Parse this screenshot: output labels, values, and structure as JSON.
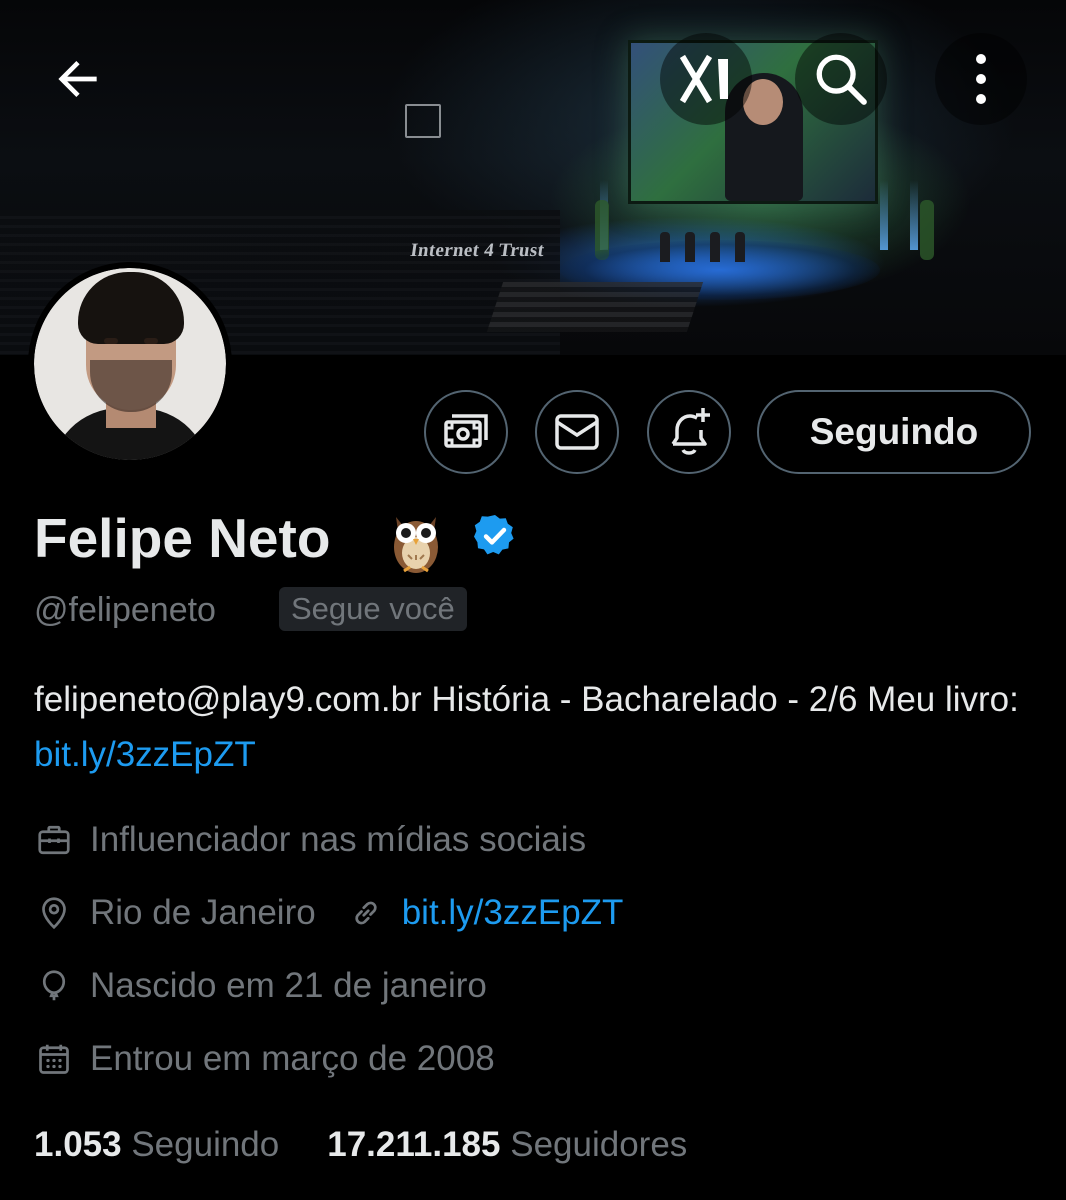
{
  "banner": {
    "sign_text": "Internet 4 Trust"
  },
  "profile": {
    "name": "Felipe Neto",
    "name_emoji": "owl",
    "verified": true,
    "handle": "@felipeneto",
    "follows_you_label": "Segue você",
    "bio": {
      "text": "felipeneto@play9.com.br História - Bacharelado - 2/6  Meu livro: ",
      "link": "bit.ly/3zzEpZT"
    },
    "category": "Influenciador nas mídias sociais",
    "location": "Rio de Janeiro",
    "website": "bit.ly/3zzEpZT",
    "birth": "Nascido em 21 de janeiro",
    "joined": "Entrou em março de 2008"
  },
  "actions": {
    "following_label": "Seguindo"
  },
  "stats": {
    "following_count": "1.053",
    "following_label": "Seguindo",
    "followers_count": "17.211.185",
    "followers_label": "Seguidores"
  },
  "colors": {
    "background": "#000000",
    "text": "#e7e9ea",
    "muted": "#71767b",
    "link": "#1d9bf0",
    "border": "#536471",
    "verified": "#1d9bf0"
  },
  "icons": {
    "back": "arrow-left-icon",
    "grok": "grok-icon",
    "search": "search-icon",
    "more": "more-vertical-icon",
    "subscribe": "subscribe-icon",
    "message": "envelope-icon",
    "notify": "bell-plus-icon",
    "category": "briefcase-icon",
    "location": "map-pin-icon",
    "website": "link-icon",
    "birth": "balloon-icon",
    "joined": "calendar-icon"
  }
}
